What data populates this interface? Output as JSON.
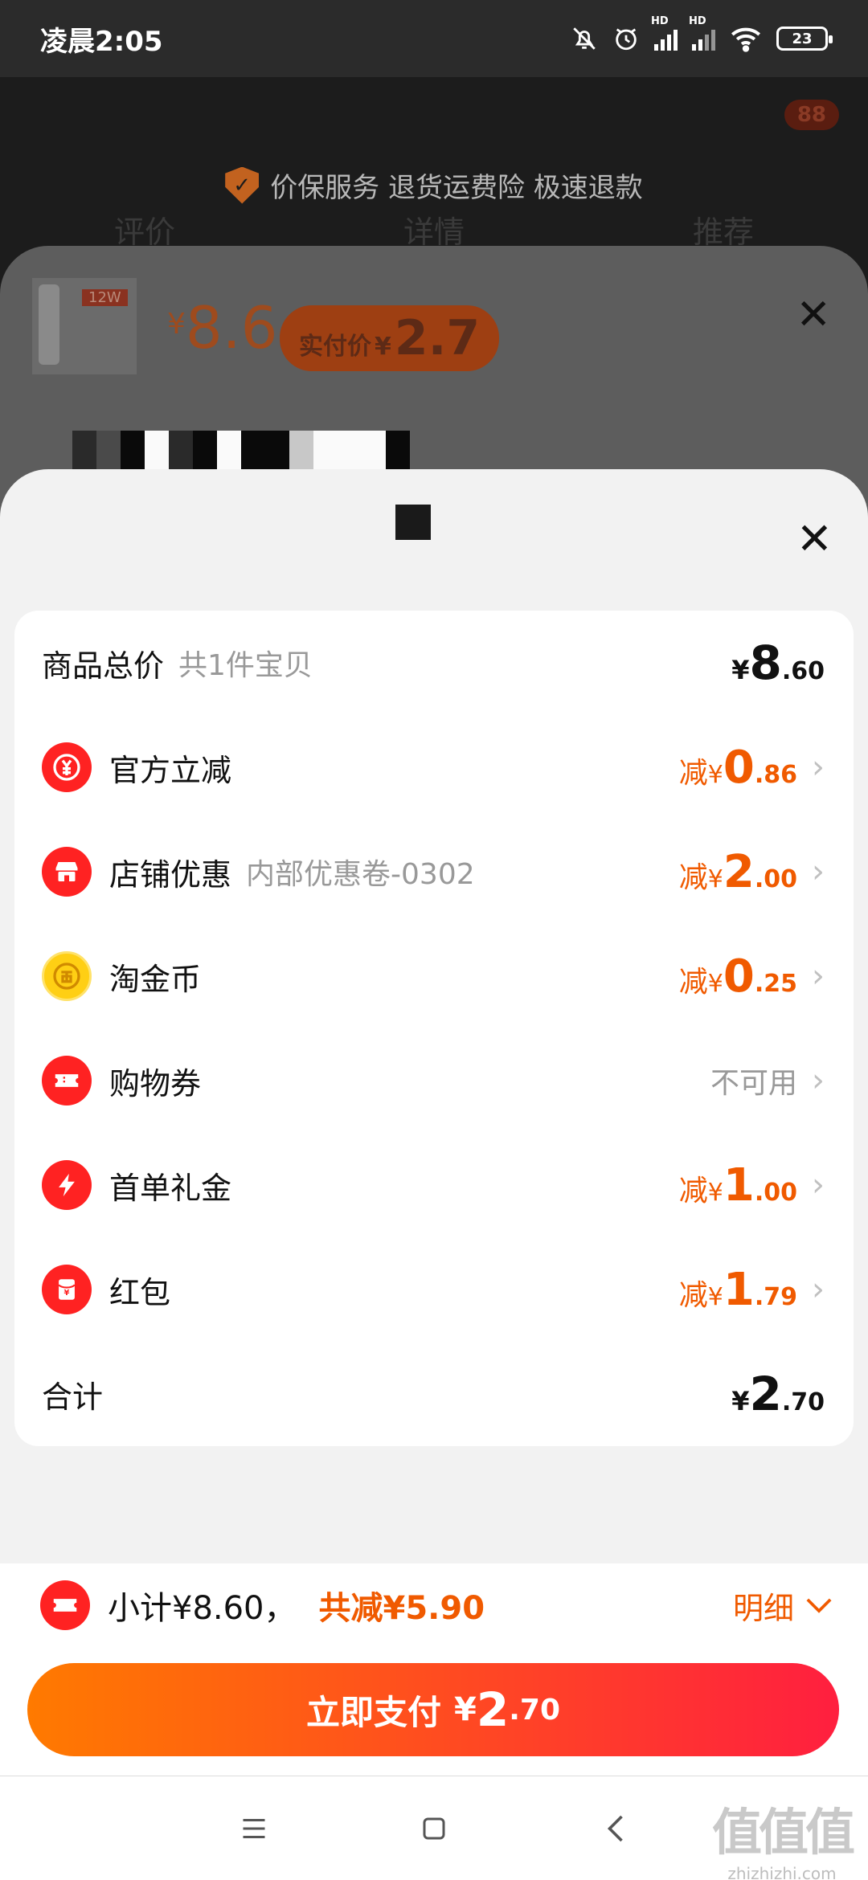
{
  "status_bar": {
    "time": "凌晨2:05",
    "signal_tag_1": "HD",
    "signal_tag_2": "HD",
    "battery": "23"
  },
  "background_page": {
    "badge": "88",
    "service_items": "价保服务 退货运费险 极速退款",
    "tabs": [
      "评价",
      "详情",
      "推荐"
    ]
  },
  "background_sheet": {
    "product_tag": "12W",
    "price_symbol": "¥",
    "price": "8.6",
    "actual_label": "实付价",
    "actual_symbol": "¥",
    "actual_price": "2.7"
  },
  "breakdown": {
    "total_row": {
      "label": "商品总价",
      "sub": "共1件宝贝",
      "yen": "¥",
      "int": "8",
      "dec": ".60"
    },
    "items": [
      {
        "name": "official-discount",
        "label": "官方立减",
        "sub": "",
        "prefix": "减",
        "yen": "¥",
        "int": "0",
        "dec": ".86",
        "icon": "yen-refresh-icon",
        "status": ""
      },
      {
        "name": "store-discount",
        "label": "店铺优惠",
        "sub": "内部优惠卷-0302",
        "prefix": "减",
        "yen": "¥",
        "int": "2",
        "dec": ".00",
        "icon": "store-icon",
        "status": ""
      },
      {
        "name": "taobao-coin",
        "label": "淘金币",
        "sub": "",
        "prefix": "减",
        "yen": "¥",
        "int": "0",
        "dec": ".25",
        "icon": "gold-coin-icon",
        "status": ""
      },
      {
        "name": "shopping-voucher",
        "label": "购物券",
        "sub": "",
        "prefix": "",
        "yen": "",
        "int": "",
        "dec": "",
        "icon": "ticket-icon",
        "status": "不可用"
      },
      {
        "name": "first-order-gift",
        "label": "首单礼金",
        "sub": "",
        "prefix": "减",
        "yen": "¥",
        "int": "1",
        "dec": ".00",
        "icon": "lightning-icon",
        "status": ""
      },
      {
        "name": "red-packet",
        "label": "红包",
        "sub": "",
        "prefix": "减",
        "yen": "¥",
        "int": "1",
        "dec": ".79",
        "icon": "red-packet-icon",
        "status": ""
      }
    ],
    "grand_total": {
      "label": "合计",
      "yen": "¥",
      "int": "2",
      "dec": ".70"
    }
  },
  "summary": {
    "subtotal": "小计¥8.60，",
    "saved": "共减¥5.90",
    "detail": "明细"
  },
  "pay_button": {
    "label": "立即支付",
    "yen": "¥",
    "int": "2",
    "dec": ".70"
  },
  "watermark": {
    "big": "值值值",
    "small": "zhizhizhi.com"
  },
  "colors": {
    "accent": "#f05a00",
    "icon_red": "#ff2222",
    "gold": "#ffcf14",
    "pay_gradient_start": "#ff7a00",
    "pay_gradient_end": "#ff1f3f"
  }
}
